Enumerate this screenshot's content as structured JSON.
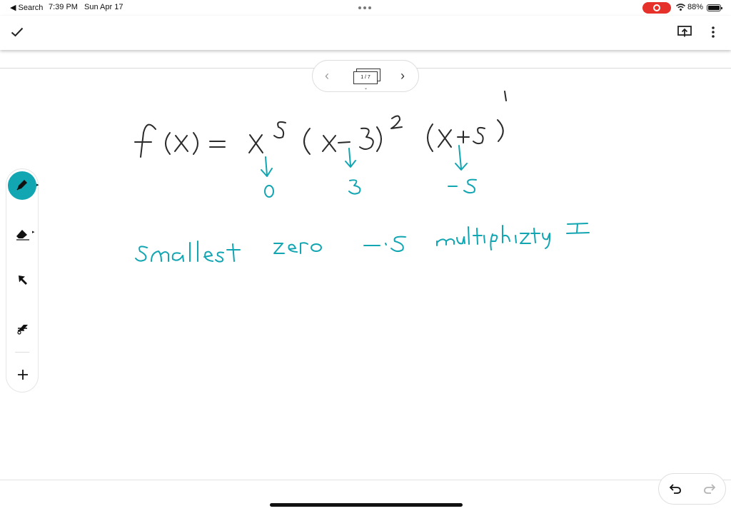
{
  "status_bar": {
    "back_app": "◀ Search",
    "time": "7:39 PM",
    "date": "Sun Apr 17",
    "battery": "88%"
  },
  "toolbar": {
    "done_icon": "checkmark-icon",
    "present_icon": "present-screen-icon",
    "more_icon": "more-vertical-icon"
  },
  "page_nav": {
    "indicator": "1 / 7",
    "prev_icon": "chevron-left-icon",
    "next_icon": "chevron-right-icon"
  },
  "tools": [
    "pen-tool",
    "highlighter-tool",
    "selection-arrow-tool",
    "eraser-tool",
    "add-tool"
  ],
  "history": {
    "undo_icon": "undo-icon",
    "redo_icon": "redo-icon"
  },
  "ink_colors": {
    "equation": "#2a2a2a",
    "annotation": "#12a5b2"
  }
}
